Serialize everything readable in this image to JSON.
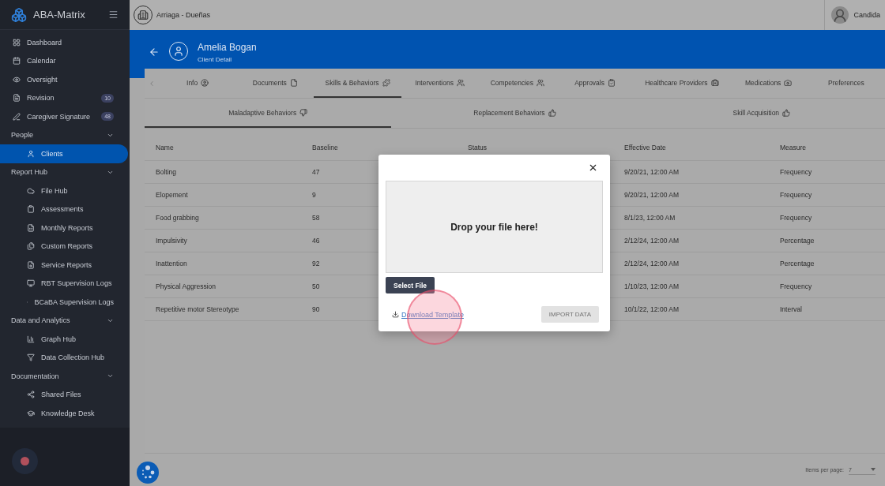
{
  "app": {
    "name": "ABA-Matrix"
  },
  "sidebar": {
    "items": [
      {
        "kind": "link",
        "label": "Dashboard",
        "selected": false
      },
      {
        "kind": "link",
        "label": "Calendar",
        "selected": false
      },
      {
        "kind": "link",
        "label": "Oversight",
        "selected": false
      },
      {
        "kind": "link",
        "label": "Revision",
        "badge": "10",
        "selected": false
      },
      {
        "kind": "link",
        "label": "Caregiver Signature",
        "badge": "48",
        "selected": false
      },
      {
        "kind": "section",
        "label": "People",
        "expanded": true,
        "children": [
          {
            "label": "Clients",
            "selected": true
          }
        ]
      },
      {
        "kind": "section",
        "label": "Report Hub",
        "expanded": true,
        "children": [
          {
            "label": "File Hub",
            "selected": false
          },
          {
            "label": "Assessments",
            "selected": false
          },
          {
            "label": "Monthly Reports",
            "selected": false
          },
          {
            "label": "Custom Reports",
            "selected": false
          },
          {
            "label": "Service Reports",
            "selected": false
          },
          {
            "label": "RBT Supervision Logs",
            "selected": false
          },
          {
            "label": "BCaBA Supervision Logs",
            "selected": false
          }
        ]
      },
      {
        "kind": "section",
        "label": "Data and Analytics",
        "expanded": true,
        "children": [
          {
            "label": "Graph Hub",
            "selected": false
          },
          {
            "label": "Data Collection Hub",
            "selected": false
          }
        ]
      },
      {
        "kind": "section",
        "label": "Documentation",
        "expanded": true,
        "children": [
          {
            "label": "Shared Files",
            "selected": false
          },
          {
            "label": "Knowledge Desk",
            "selected": false
          }
        ]
      }
    ]
  },
  "topbar": {
    "organization": "Arriaga - Dueñas",
    "user": "Candida"
  },
  "header": {
    "title": "Amelia Bogan",
    "subtitle": "Client Detail"
  },
  "tabs": [
    {
      "label": "Info",
      "selected": false
    },
    {
      "label": "Documents",
      "selected": false
    },
    {
      "label": "Skills & Behaviors",
      "selected": true
    },
    {
      "label": "Interventions",
      "selected": false
    },
    {
      "label": "Competencies",
      "selected": false
    },
    {
      "label": "Approvals",
      "selected": false
    },
    {
      "label": "Healthcare Providers",
      "selected": false
    },
    {
      "label": "Medications",
      "selected": false
    },
    {
      "label": "Preferences",
      "selected": false
    }
  ],
  "subtabs": [
    {
      "label": "Maladaptive Behaviors",
      "selected": true
    },
    {
      "label": "Replacement Behaviors",
      "selected": false
    },
    {
      "label": "Skill Acquisition",
      "selected": false
    }
  ],
  "table": {
    "columns": [
      "Name",
      "Baseline",
      "Status",
      "Effective Date",
      "Measure"
    ],
    "rows": [
      {
        "name": "Bolting",
        "baseline": "47",
        "effective_date": "9/20/21, 12:00 AM",
        "measure": "Frequency"
      },
      {
        "name": "Elopement",
        "baseline": "9",
        "effective_date": "9/20/21, 12:00 AM",
        "measure": "Frequency"
      },
      {
        "name": "Food grabbing",
        "baseline": "58",
        "effective_date": "8/1/23, 12:00 AM",
        "measure": "Frequency"
      },
      {
        "name": "Impulsivity",
        "baseline": "46",
        "effective_date": "2/12/24, 12:00 AM",
        "measure": "Percentage"
      },
      {
        "name": "Inattention",
        "baseline": "92",
        "effective_date": "2/12/24, 12:00 AM",
        "measure": "Percentage"
      },
      {
        "name": "Physical Aggression",
        "baseline": "50",
        "effective_date": "1/10/23, 12:00 AM",
        "measure": "Frequency"
      },
      {
        "name": "Repetitive motor Stereotype",
        "baseline": "90",
        "effective_date": "10/1/22, 12:00 AM",
        "measure": "Interval"
      }
    ]
  },
  "pagination": {
    "label": "Items per page:",
    "value": "7"
  },
  "modal": {
    "drop_text": "Drop your file here!",
    "select_button": "Select File",
    "download_link": "Download Template",
    "import_button": {
      "label": "IMPORT DATA",
      "disabled": true
    }
  }
}
